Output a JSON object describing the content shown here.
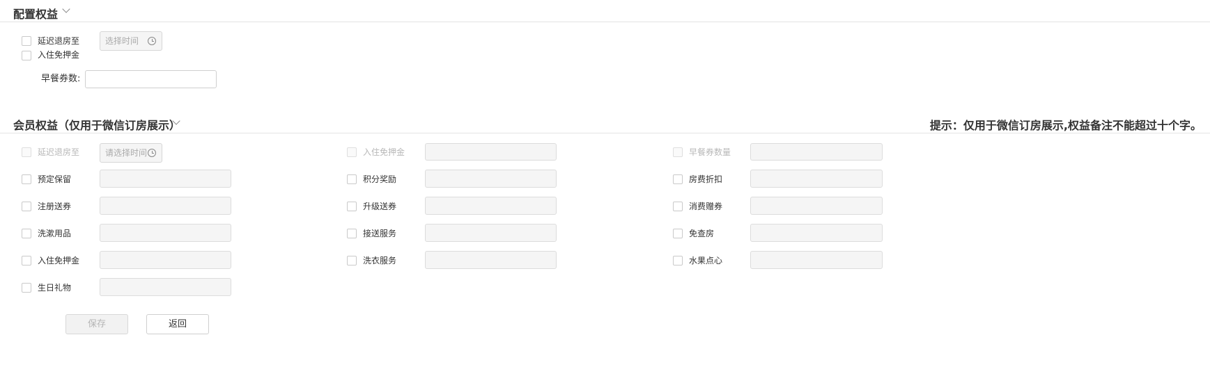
{
  "config_section": {
    "title": "配置权益",
    "late_checkout_label": "延迟退房至",
    "late_checkout_time_placeholder": "选择时间",
    "deposit_free_label": "入住免押金",
    "breakfast_label": "早餐券数:",
    "breakfast_value": ""
  },
  "member_section": {
    "title": "会员权益（仅用于微信订房展示）",
    "hint": "提示：仅用于微信订房展示,权益备注不能超过十个字。",
    "late_checkout_label": "延迟退房至",
    "late_checkout_time_placeholder": "请选择时间",
    "rows": [
      {
        "col1": "预定保留",
        "col2": "积分奖励",
        "col3": "房费折扣"
      },
      {
        "col1": "注册送券",
        "col2": "升级送券",
        "col3": "消费赠券"
      },
      {
        "col1": "洗漱用品",
        "col2": "接送服务",
        "col3": "免查房"
      },
      {
        "col1": "入住免押金",
        "col2": "洗衣服务",
        "col3": "水果点心"
      }
    ],
    "first_row": {
      "col2": "入住免押金",
      "col3": "早餐券数量"
    },
    "last_item": "生日礼物"
  },
  "actions": {
    "save_label": "保存",
    "back_label": "返回"
  }
}
